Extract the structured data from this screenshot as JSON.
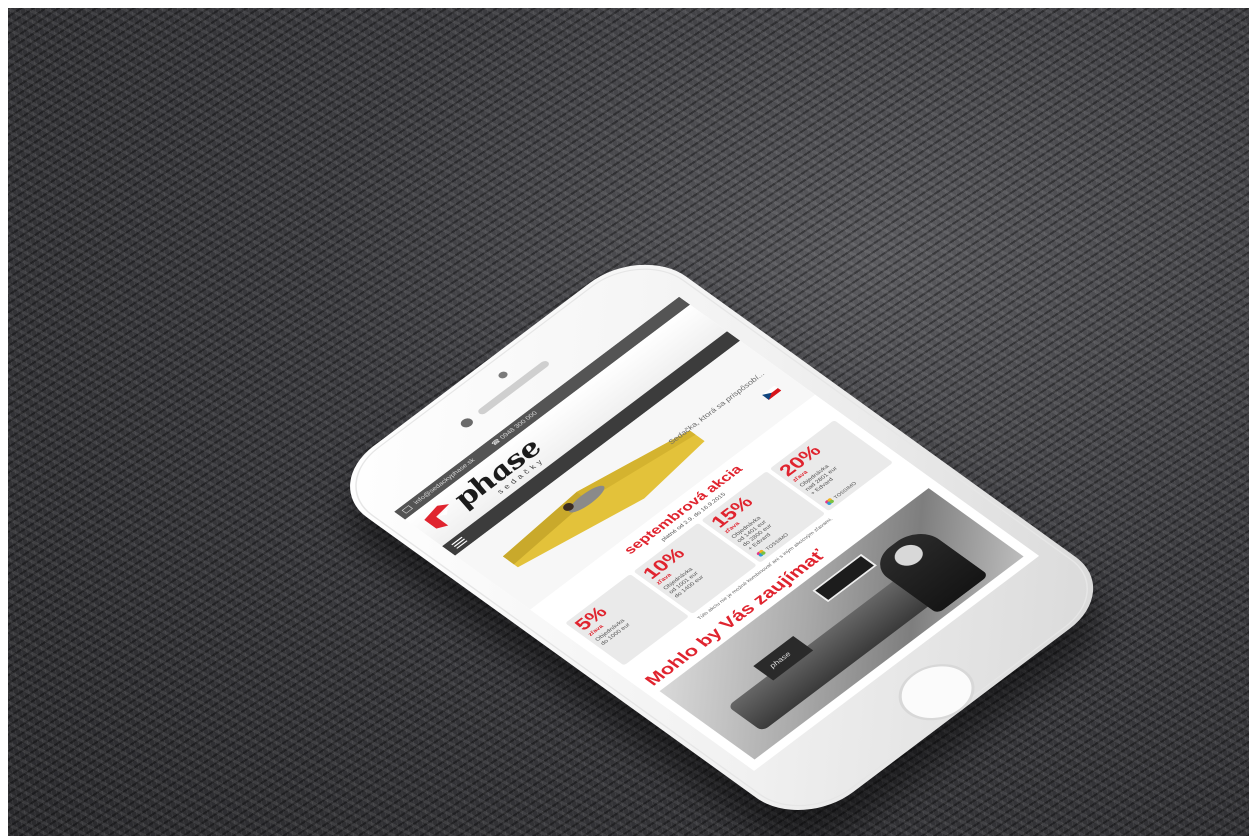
{
  "site": {
    "url_bar_text": "info@sedackyphase.sk",
    "phone_text": "0948 300 000",
    "logo_text": "phase",
    "logo_sub": "sedačky",
    "tagline": "Sedačka, ktorá sa prispôsobí..."
  },
  "promo": {
    "title": "septembrová akcia",
    "dates": "platné od 2.9. do 16.9.2015",
    "tiers": [
      {
        "pct": "5%",
        "word": "zľava",
        "desc": "Objednávka\ndo 1000 eur",
        "tossimo": ""
      },
      {
        "pct": "10%",
        "word": "zľava",
        "desc": "Objednávka\nod 1001 eur\ndo 1400 eur",
        "tossimo": ""
      },
      {
        "pct": "15%",
        "word": "zľava",
        "desc": "Objednávka\nod 1401 eur\ndo 2800 eur\n+ Edvard",
        "tossimo": "TOSSIMO"
      },
      {
        "pct": "20%",
        "word": "zľava",
        "desc": "Objednávka\nnad 2801 eur\n+ Edvard",
        "tossimo": "TOSSIMO"
      }
    ],
    "note": "Túto akciu nie je možné kombinovať ani s iným akciovým zľavami."
  },
  "section": {
    "title": "Mohlo by Vás zaujímať",
    "photo_pillow_label": "phase"
  },
  "colors": {
    "brand_red": "#e0242f",
    "nav_dark": "#3c3c3c",
    "sofa_yellow": "#e3c23a"
  },
  "icons": [
    "mail-icon",
    "phone-icon",
    "menu-icon",
    "flag-icon",
    "tossimo-icon"
  ]
}
